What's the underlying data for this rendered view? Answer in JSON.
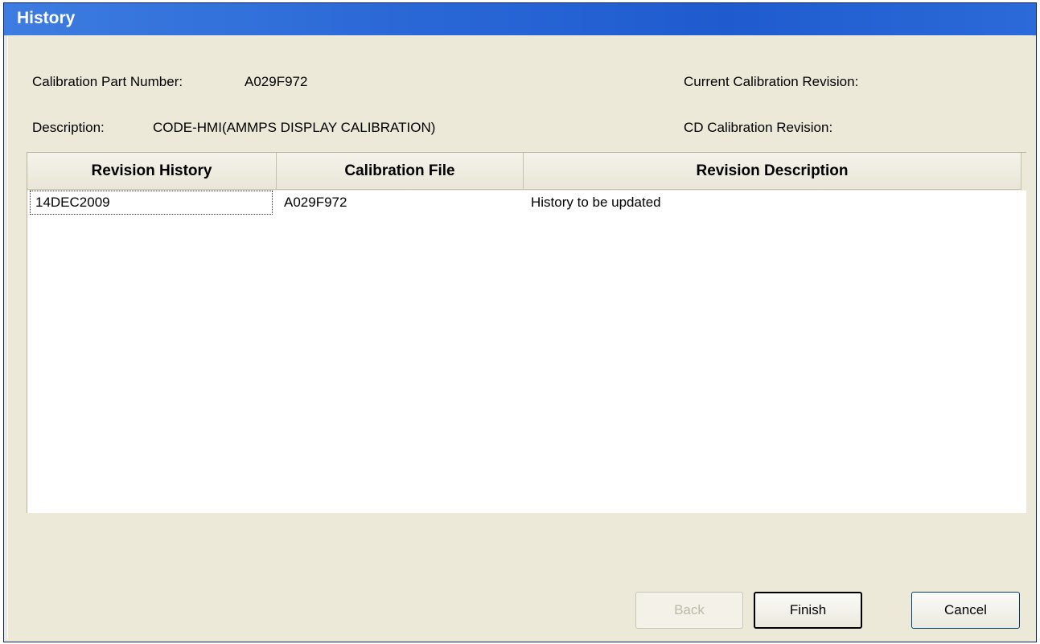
{
  "window": {
    "title": "History"
  },
  "fields": {
    "part_number_label": "Calibration Part Number:",
    "part_number_value": "A029F972",
    "description_label": "Description:",
    "description_value": "CODE-HMI(AMMPS DISPLAY CALIBRATION)",
    "current_rev_label": "Current Calibration Revision:",
    "current_rev_value": "",
    "cd_rev_label": "CD Calibration Revision:",
    "cd_rev_value": ""
  },
  "table": {
    "columns": [
      "Revision History",
      "Calibration File",
      "Revision Description"
    ],
    "rows": [
      [
        "14DEC2009",
        "A029F972",
        "History to be updated"
      ]
    ]
  },
  "buttons": {
    "back": "Back",
    "finish": "Finish",
    "cancel": "Cancel"
  },
  "colors": {
    "titlebar": "#2a67d6",
    "dialog_bg": "#ece9d8",
    "grid_bg": "#ffffff"
  }
}
